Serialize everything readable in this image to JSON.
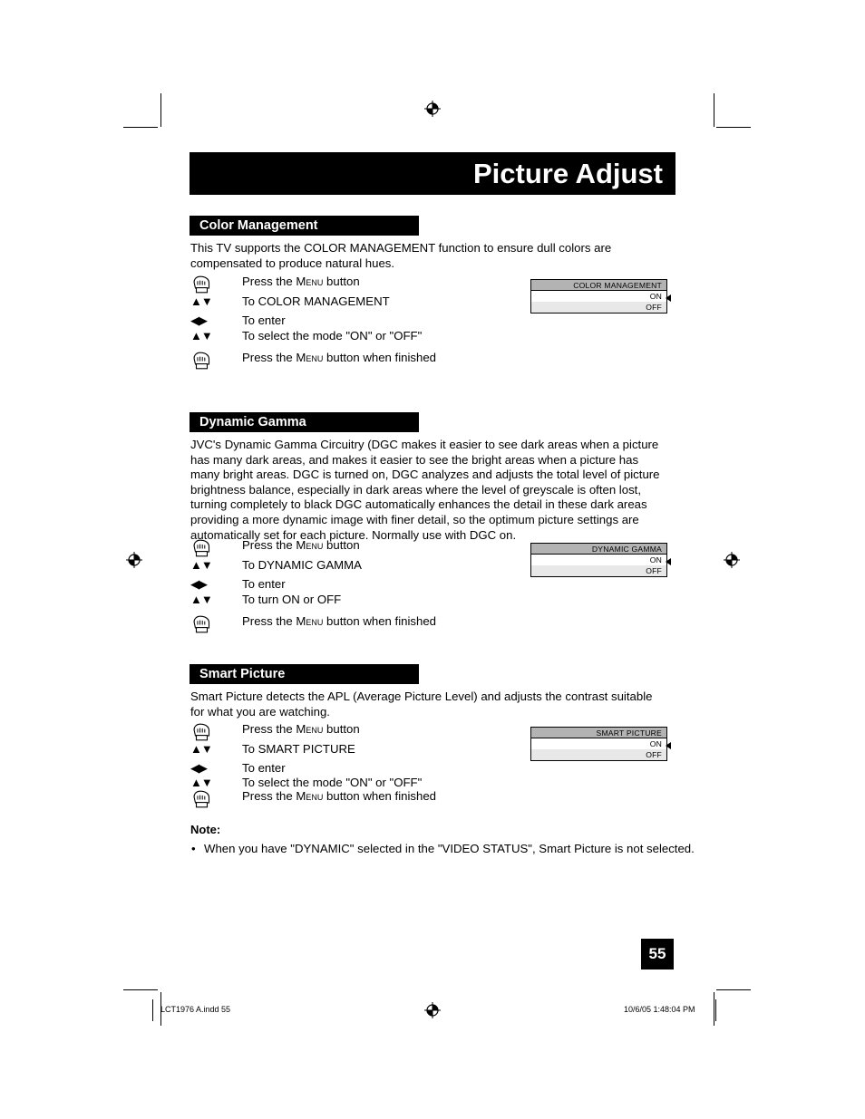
{
  "page": {
    "title": "Picture Adjust",
    "number": "55"
  },
  "sections": [
    {
      "heading": "Color Management",
      "body": "This TV supports the COLOR MANAGEMENT function to ensure dull colors are compensated to produce natural hues.",
      "steps": [
        {
          "icon": "hand-press-icon",
          "label_pre": "Press the ",
          "label_sc": "Menu",
          "label_post": " button"
        },
        {
          "icon": "up-down-arrows-icon",
          "label_pre": "To COLOR MANAGEMENT",
          "label_sc": "",
          "label_post": ""
        },
        {
          "icon": "left-right-arrows-icon",
          "label_pre": "To enter",
          "label_sc": "",
          "label_post": ""
        },
        {
          "icon": "up-down-arrows-icon",
          "label_pre": "To select the mode \"ON\" or \"OFF\"",
          "label_sc": "",
          "label_post": ""
        },
        {
          "icon": "hand-press-icon",
          "label_pre": "Press the ",
          "label_sc": "Menu",
          "label_post": " button when finished"
        }
      ],
      "osd": {
        "title": "COLOR MANAGEMENT",
        "rows": [
          "ON",
          "OFF"
        ]
      }
    },
    {
      "heading": "Dynamic Gamma",
      "body": "JVC's Dynamic Gamma Circuitry (DGC makes it easier to see dark areas when a picture has many dark areas, and makes it easier to see the bright areas when a picture has many bright areas.  DGC is turned on, DGC analyzes and adjusts the total level of picture brightness balance, especially in dark areas where the level of greyscale is often lost, turning completely to black DGC automatically enhances the detail in these dark areas providing a more dynamic image with finer detail, so the optimum picture settings are automatically set for each picture. Normally use with DGC on.",
      "steps": [
        {
          "icon": "hand-press-icon",
          "label_pre": "Press the ",
          "label_sc": "Menu",
          "label_post": " button"
        },
        {
          "icon": "up-down-arrows-icon",
          "label_pre": "To DYNAMIC GAMMA",
          "label_sc": "",
          "label_post": ""
        },
        {
          "icon": "left-right-arrows-icon",
          "label_pre": "To enter",
          "label_sc": "",
          "label_post": ""
        },
        {
          "icon": "up-down-arrows-icon",
          "label_pre": "To turn ON or OFF",
          "label_sc": "",
          "label_post": ""
        },
        {
          "icon": "hand-press-icon",
          "label_pre": "Press the ",
          "label_sc": "Menu",
          "label_post": " button when finished"
        }
      ],
      "osd": {
        "title": "DYNAMIC GAMMA",
        "rows": [
          "ON",
          "OFF"
        ]
      }
    },
    {
      "heading": "Smart Picture",
      "body": "Smart Picture detects the APL (Average Picture Level) and adjusts the contrast suitable for what you are watching.",
      "steps": [
        {
          "icon": "hand-press-icon",
          "label_pre": "Press the ",
          "label_sc": "Menu",
          "label_post": " button"
        },
        {
          "icon": "up-down-arrows-icon",
          "label_pre": "To SMART PICTURE",
          "label_sc": "",
          "label_post": ""
        },
        {
          "icon": "left-right-arrows-icon",
          "label_pre": "To enter",
          "label_sc": "",
          "label_post": ""
        },
        {
          "icon": "up-down-arrows-icon",
          "label_pre": "To select the mode \"ON\" or \"OFF\"",
          "label_sc": "",
          "label_post": ""
        },
        {
          "icon": "hand-press-icon",
          "label_pre": "Press the ",
          "label_sc": "Menu",
          "label_post": " button when finished"
        }
      ],
      "osd": {
        "title": "SMART PICTURE",
        "rows": [
          "ON",
          "OFF"
        ]
      }
    }
  ],
  "note": {
    "heading": "Note:",
    "bullet": "•",
    "items": [
      "When you have \"DYNAMIC\" selected in the \"VIDEO STATUS\", Smart Picture is not selected."
    ]
  },
  "footer": {
    "left": "LCT1976 A.indd   55",
    "right": "10/6/05   1:48:04 PM"
  },
  "colors": {
    "banner_bg": "#000000",
    "banner_fg": "#ffffff",
    "osd_title_bg": "#b3b3b3",
    "osd_on_bg": "#ffffff",
    "osd_off_bg": "#e8e8e8"
  }
}
